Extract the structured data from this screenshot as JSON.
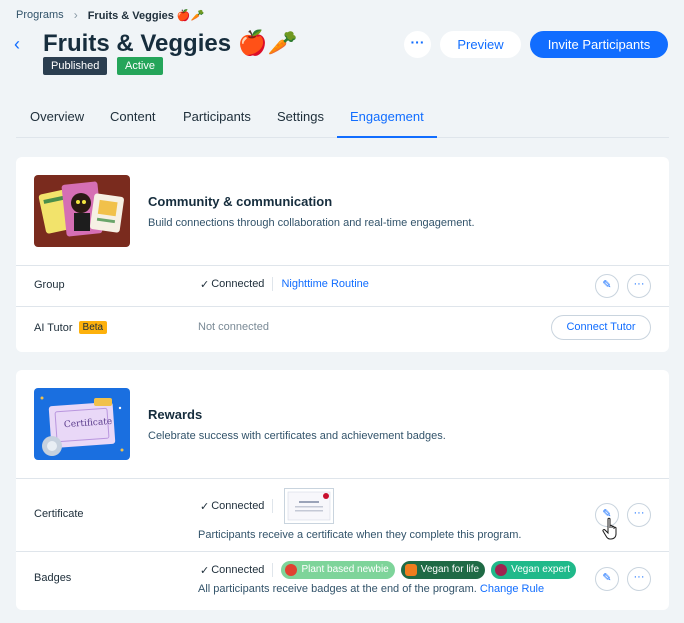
{
  "breadcrumb": {
    "root": "Programs",
    "current": "Fruits & Veggies 🍎🥕"
  },
  "header": {
    "title": "Fruits & Veggies 🍎🥕",
    "badges": [
      "Published",
      "Active"
    ],
    "more_label": "···",
    "preview_label": "Preview",
    "invite_label": "Invite Participants"
  },
  "tabs": [
    "Overview",
    "Content",
    "Participants",
    "Settings",
    "Engagement"
  ],
  "active_tab": "Engagement",
  "community": {
    "title": "Community & communication",
    "description": "Build connections through collaboration and real-time engagement.",
    "group": {
      "label": "Group",
      "status": "Connected",
      "linked": "Nighttime Routine"
    },
    "ai_tutor": {
      "label": "AI Tutor",
      "tag": "Beta",
      "status": "Not connected",
      "button": "Connect Tutor"
    }
  },
  "rewards": {
    "title": "Rewards",
    "description": "Celebrate success with certificates and achievement badges.",
    "image_text": "Certificate",
    "certificate": {
      "label": "Certificate",
      "status": "Connected",
      "note": "Participants receive a certificate when they complete this program."
    },
    "badges": {
      "label": "Badges",
      "status": "Connected",
      "items": [
        "Plant based newbie",
        "Vegan for life",
        "Vegan expert"
      ],
      "note": "All participants receive badges at the end of the program.",
      "link": "Change Rule"
    }
  },
  "colors": {
    "accent": "#116dff",
    "published": "#2b3e50",
    "active": "#25a55a",
    "beta": "#fdb10c"
  }
}
